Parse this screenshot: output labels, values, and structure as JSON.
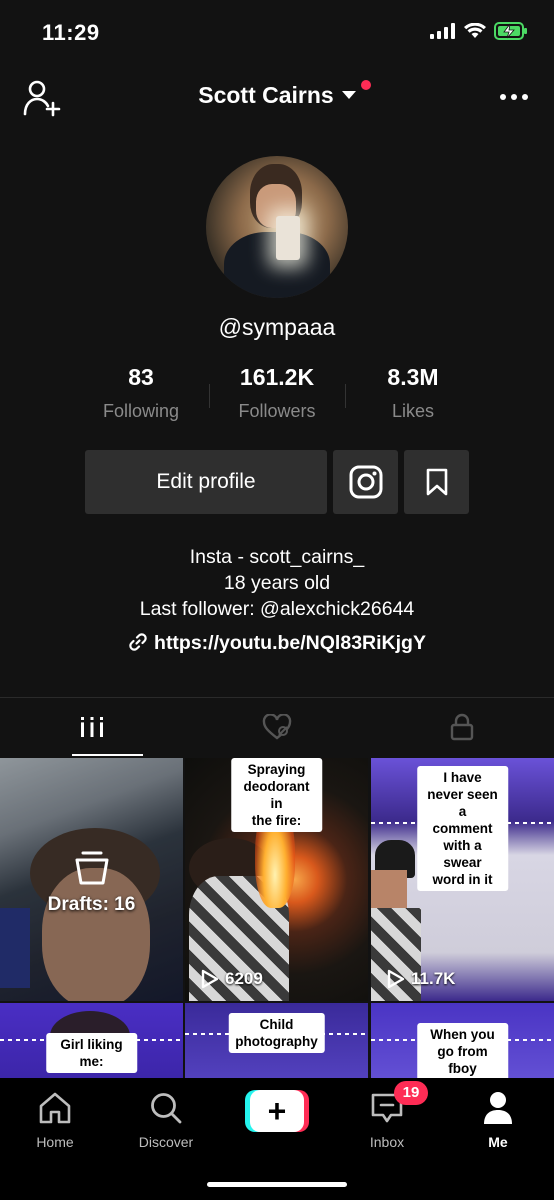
{
  "status": {
    "time": "11:29"
  },
  "header": {
    "title": "Scott Cairns"
  },
  "profile": {
    "username": "@sympaaa",
    "stats": [
      {
        "value": "83",
        "label": "Following"
      },
      {
        "value": "161.2K",
        "label": "Followers"
      },
      {
        "value": "8.3M",
        "label": "Likes"
      }
    ],
    "edit_label": "Edit profile",
    "bio_lines": [
      "Insta - scott_cairns_",
      "18 years old",
      "Last follower: @alexchick26644"
    ],
    "link": "https://youtu.be/NQl83RiKjgY"
  },
  "grid": {
    "drafts_label": "Drafts: 16",
    "items": [
      {
        "caption": "Spraying deodorant in\nthe fire:",
        "views": "6209"
      },
      {
        "caption": "I have never seen a\ncomment with a swear\nword in it",
        "views": "11.7K"
      },
      {
        "caption": "Girl liking me:"
      },
      {
        "caption": "Child photography"
      },
      {
        "caption": "When you go from fboy\nto simp"
      }
    ]
  },
  "nav": {
    "items": [
      {
        "label": "Home",
        "icon": "home-icon"
      },
      {
        "label": "Discover",
        "icon": "search-icon"
      },
      {
        "label": "Inbox",
        "icon": "inbox-icon"
      },
      {
        "label": "Me",
        "icon": "profile-icon"
      }
    ],
    "inbox_badge": "19"
  },
  "colors": {
    "accent": "#fe2c55",
    "cyan": "#25f4ee",
    "background": "#121212"
  }
}
